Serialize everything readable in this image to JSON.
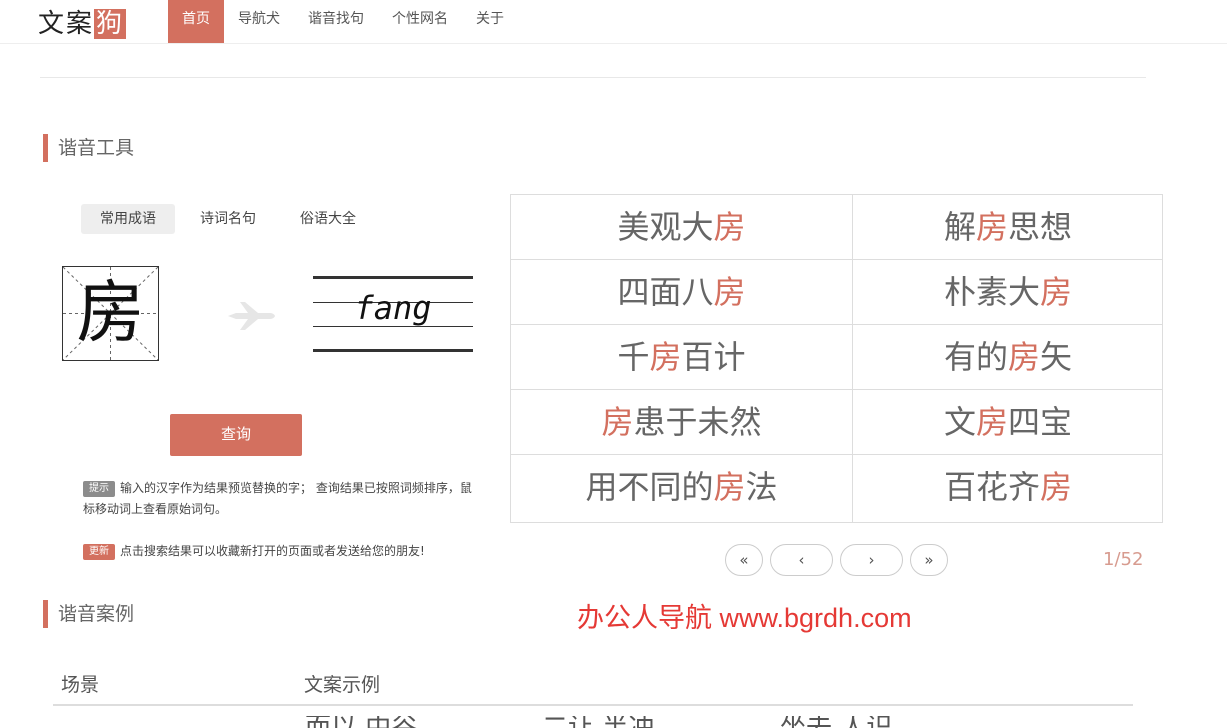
{
  "logo": {
    "prefix": "文案",
    "highlight": "狗"
  },
  "nav": [
    "首页",
    "导航犬",
    "谐音找句",
    "个性网名",
    "关于"
  ],
  "section1_title": "谐音工具",
  "tabs": [
    "常用成语",
    "诗词名句",
    "俗语大全"
  ],
  "input_char": "房",
  "pinyin": "fang",
  "query_label": "查询",
  "tip": {
    "badge": "提示",
    "text": "输入的汉字作为结果预览替换的字； 查询结果已按照词频排序，鼠标移动词上查看原始词句。"
  },
  "update": {
    "badge": "更新",
    "text": "点击搜索结果可以收藏新打开的页面或者发送给您的朋友!"
  },
  "results": [
    {
      "pre": "美观大",
      "hl": "房",
      "post": ""
    },
    {
      "pre": "解",
      "hl": "房",
      "post": "思想"
    },
    {
      "pre": "四面八",
      "hl": "房",
      "post": ""
    },
    {
      "pre": "朴素大",
      "hl": "房",
      "post": ""
    },
    {
      "pre": "千",
      "hl": "房",
      "post": "百计"
    },
    {
      "pre": "有的",
      "hl": "房",
      "post": "矢"
    },
    {
      "pre": "",
      "hl": "房",
      "post": "患于未然"
    },
    {
      "pre": "文",
      "hl": "房",
      "post": "四宝"
    },
    {
      "pre": "用不同的",
      "hl": "房",
      "post": "法"
    },
    {
      "pre": "百花齐",
      "hl": "房",
      "post": ""
    }
  ],
  "pager": {
    "first": "«",
    "prev": "‹",
    "next": "›",
    "last": "»",
    "count": "1/52"
  },
  "watermark": "办公人导航 www.bgrdh.com",
  "section2_title": "谐音案例",
  "table": {
    "col1": "场景",
    "col2": "文案示例"
  },
  "cutoff_text": [
    "而以 中谷",
    "二让 半冲",
    "坐去 人识"
  ],
  "colors": {
    "accent": "#d3705f",
    "watermark": "#e53935"
  },
  "icons": {
    "plane": "airplane-icon"
  }
}
